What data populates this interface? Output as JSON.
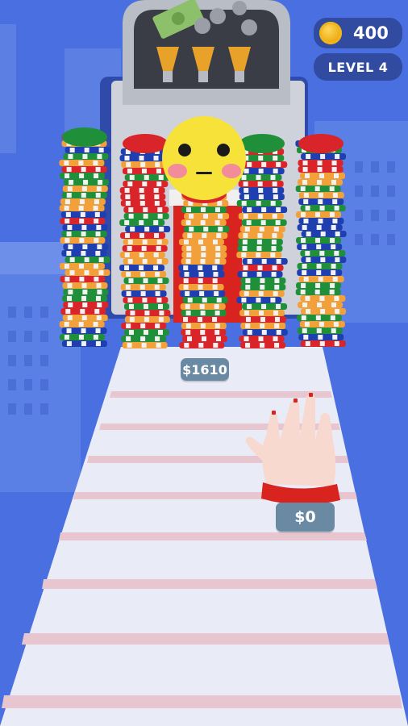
{
  "hud": {
    "coin_count": "400",
    "level_label": "LEVEL 4"
  },
  "stack_total_label": "$1610",
  "hand_money_label": "$0",
  "emoji": {
    "expression": "flushed-face"
  },
  "machine": {
    "banknote_symbol": "$"
  },
  "colors": {
    "sky": "#4a6fe0",
    "track": "#e9ecf6",
    "track_stripe": "#e8c6cf",
    "chip_red": "#d9242a",
    "chip_green": "#1f8f3a",
    "chip_blue": "#1f3fb0",
    "chip_orange": "#f2a03a",
    "chip_white": "#f2f2f2",
    "sleeve_red": "#d8231f"
  },
  "icons": [
    "coin-icon",
    "banknote-icon",
    "lightbulb-icon",
    "hand-icon"
  ]
}
